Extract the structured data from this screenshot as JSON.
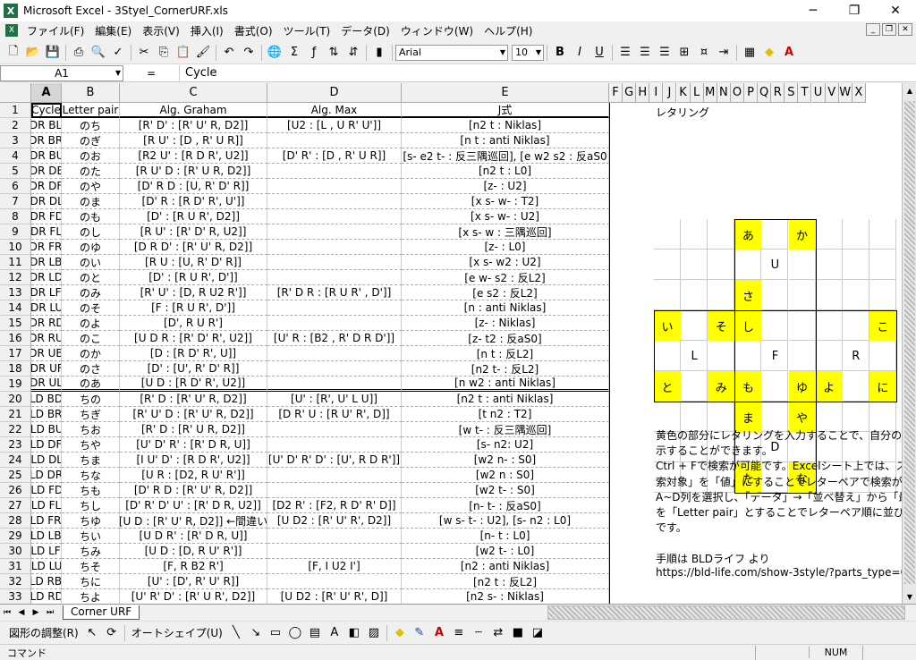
{
  "window": {
    "title": "Microsoft Excel - 3Styel_CornerURF.xls",
    "app_icon": "X"
  },
  "menu": [
    "ファイル(F)",
    "編集(E)",
    "表示(V)",
    "挿入(I)",
    "書式(O)",
    "ツール(T)",
    "データ(D)",
    "ウィンドウ(W)",
    "ヘルプ(H)"
  ],
  "toolbar": {
    "font": "Arial",
    "size": "10",
    "bold": "B",
    "italic": "I",
    "underline": "U"
  },
  "formula_bar": {
    "name_box": "A1",
    "equals": "=",
    "content": "Cycle"
  },
  "columns": [
    "A",
    "B",
    "C",
    "D",
    "E",
    "F",
    "G",
    "H",
    "I",
    "J",
    "K",
    "L",
    "M",
    "N",
    "O",
    "P",
    "Q",
    "R",
    "S",
    "T",
    "U",
    "V",
    "W",
    "X"
  ],
  "headers": [
    "Cycle",
    "Letter pair",
    "Alg. Graham",
    "Alg. Max",
    "J式"
  ],
  "rows": [
    [
      "BDR BLD",
      "のち",
      "[R' D' : [R' U' R, D2]]",
      "[U2 : [L , U R' U']]",
      "[n2 t : Niklas]"
    ],
    [
      "BDR BRU",
      "のぎ",
      "[R U' : [D , R' U R]]",
      "",
      "[n t : anti Niklas]"
    ],
    [
      "BDR BUL",
      "のお",
      "[R2 U' : [R D R', U2]]",
      "[D' R' : [D , R' U R]]",
      "[s- e2 t- : 反三隅巡回], [e w2 s2 : 反aS0"
    ],
    [
      "BDR DBL",
      "のた",
      "[R U' D : [R' U R, D2]]",
      "",
      "[n2 t : L0]"
    ],
    [
      "BDR DFR",
      "のや",
      "[D' R D : [U, R' D' R]]",
      "",
      "[z- : U2]"
    ],
    [
      "BDR DLF",
      "のま",
      "[D' R : [R D' R', U']]",
      "",
      "[x s- w- : T2]"
    ],
    [
      "BDR FDL",
      "のも",
      "[D' : [R U R', D2]]",
      "",
      "[x s- w- : U2]"
    ],
    [
      "BDR FLU",
      "のし",
      "[R U' : [R' D' R, U2]]",
      "",
      "[x s- w : 三隅巡回]"
    ],
    [
      "BDR FRD",
      "のゆ",
      "[D R D' : [R' U' R, D2]]",
      "",
      "[z- : L0]"
    ],
    [
      "BDR LBU",
      "のい",
      "[R U : [U, R' D' R]]",
      "",
      "[x s- w2 : U2]"
    ],
    [
      "BDR LDB",
      "のと",
      "[D' : [R U R', D']]",
      "",
      "[e w- s2 : 反L2]"
    ],
    [
      "BDR LFD",
      "のみ",
      "[R' U' : [D, R U2 R']]",
      "[R' D R : [R U R' , D']]",
      "[e s2 : 反L2]"
    ],
    [
      "BDR LUF",
      "のそ",
      "[F : [R U R', D']]",
      "",
      "[n : anti Niklas]"
    ],
    [
      "BDR RDF",
      "のよ",
      "[D', R U R']",
      "",
      "[z- : Niklas]"
    ],
    [
      "BDR RUB",
      "のこ",
      "[U D R : [R' D' R', U2]]",
      "[U' R : [B2 , R' D R D']]",
      "[z- t2 : 反aS0]"
    ],
    [
      "BDR UBR",
      "のか",
      "[D : [R D' R', U]]",
      "",
      "[n t : 反L2]"
    ],
    [
      "BDR UFL",
      "のさ",
      "[D' : [U', R' D' R]]",
      "",
      "[n2 t- : 反L2]"
    ],
    [
      "BDR ULB",
      "のあ",
      "[U D : [R D' R', U2]]",
      "",
      "[n w2 : anti Niklas]"
    ],
    [
      "BLD BDR",
      "ちの",
      "[R' D : [R' U' R, D2]]",
      "[U' : [R', U' L U]]",
      "[n2 t : anti Niklas]"
    ],
    [
      "BLD BRU",
      "ちぎ",
      "[R' U' D : [R' U' R, D2]]",
      "[D R' U : [R U' R', D]]",
      "[t n2 : T2]"
    ],
    [
      "BLD BUL",
      "ちお",
      "[R' D : [R' U R, D2]]",
      "",
      "[w t- : 反三隅巡回]"
    ],
    [
      "BLD DFR",
      "ちや",
      "[U' D' R' : [R' D R, U]]",
      "",
      "[s- n2: U2]"
    ],
    [
      "BLD DLF",
      "ちま",
      "[I U' D' : [R D R', U2]]",
      "[U' D' R' D' : [U', R D R']]",
      "[w2 n- : S0]"
    ],
    [
      "BLD DRB",
      "ちな",
      "[U R : [D2, R U' R']]",
      "",
      "[w2 n : S0]"
    ],
    [
      "BLD FDL",
      "ちも",
      "[D' R D : [R' U' R, D2]]",
      "",
      "[w2 t- : S0]"
    ],
    [
      "BLD FLU",
      "ちし",
      "[D' R' D' U' : [R' D R, U2]]",
      "[D2 R' : [F2, R D' R' D]]",
      "[n- t- : 反aS0]"
    ],
    [
      "BLD FRD",
      "ちゆ",
      "[U D : [R' U' R, D2]] ←間違い",
      "[U D2 : [R' U' R', D2]]",
      "[w s- t- : U2], [s- n2 : L0]"
    ],
    [
      "BLD LBU",
      "ちい",
      "[U D R' : [R' D R, U]]",
      "",
      "[n- t : L0]"
    ],
    [
      "BLD LFD",
      "ちみ",
      "[U D : [D, R U' R']]",
      "",
      "[w2 t- : L0]"
    ],
    [
      "BLD LUF",
      "ちそ",
      "[F, R B2 R']",
      "[F, I U2 I']",
      "[n2 : anti Niklas]"
    ],
    [
      "BLD RBD",
      "ちに",
      "[U' : [D', R' U' R]]",
      "",
      "[n2 t : 反L2]"
    ],
    [
      "BLD RDF",
      "ちよ",
      "[U' R' D' : [R' U R', D2]]",
      "[U D2 : [R' U' R', D]]",
      "[n2 s- : Niklas]"
    ]
  ],
  "lettering": {
    "title": "レタリング",
    "U_label": "U",
    "F_label": "F",
    "L_label": "L",
    "R_label": "R",
    "D_label": "D",
    "letters": {
      "u_tl": "あ",
      "u_tr": "か",
      "u_bl": "さ",
      "l_tl": "い",
      "l_tr": "そ",
      "l_bl": "と",
      "l_br": "み",
      "f_tl": "し",
      "f_bl": "も",
      "f_br": "ゆ",
      "r_tl": "よ",
      "r_tr": "こ",
      "r_br": "に",
      "d_tl": "ま",
      "d_tr": "や",
      "d_bl": "た",
      "d_br": "な"
    }
  },
  "notes": [
    "黄色の部分にレタリングを入力することで、自分の",
    "示することができます。",
    "Ctrl + Fで検索が可能です。Excelシート上では、ス",
    "索対象」を「値」にすることでレターペアで検索がで",
    "A~D列を選択し、「データ」→「並べ替え」から「最優",
    "を「Letter pair」とすることでレターペア順に並び替え",
    "です。",
    "",
    "手順は BLDライフ より",
    "https://bld-life.com/show-3style/?parts_type=Co"
  ],
  "sheet_tab": "Corner URF",
  "drawing": {
    "adjust": "図形の調整(R)",
    "autoshape": "オートシェイプ(U)"
  },
  "status": {
    "mode": "コマンド",
    "num": "NUM"
  }
}
